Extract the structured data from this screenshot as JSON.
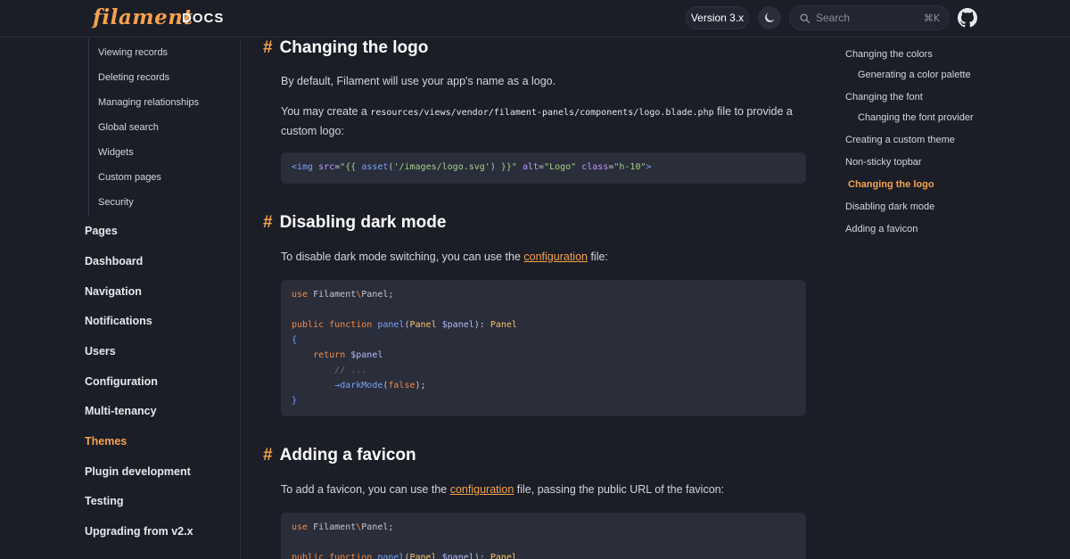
{
  "brand": {
    "wordmark": "filament",
    "docs_label": "DOCS"
  },
  "header": {
    "version_label": "Version 3.x",
    "search_placeholder": "Search",
    "search_shortcut": "⌘K"
  },
  "sidebar": {
    "sub_items": [
      "Viewing records",
      "Deleting records",
      "Managing relationships",
      "Global search",
      "Widgets",
      "Custom pages",
      "Security"
    ],
    "top_items": [
      "Pages",
      "Dashboard",
      "Navigation",
      "Notifications",
      "Users",
      "Configuration",
      "Multi-tenancy",
      "Themes",
      "Plugin development",
      "Testing",
      "Upgrading from v2.x"
    ],
    "active_item": "Themes"
  },
  "content": {
    "section_logo": {
      "heading": "Changing the logo",
      "para1": "By default, Filament will use your app's name as a logo.",
      "para2_before": "You may create a ",
      "para2_code": "resources/views/vendor/filament-panels/components/logo.blade.php",
      "para2_after": " file to provide a",
      "para2_line2": "custom logo:",
      "code": "<img src=\"{{ asset('/images/logo.svg') }}\" alt=\"Logo\" class=\"h-10\">"
    },
    "section_dark": {
      "heading": "Disabling dark mode",
      "para_before": "To disable dark mode switching, you can use the ",
      "para_link": "configuration",
      "para_after": " file:",
      "code_lines": [
        "use Filament\\Panel;",
        "",
        "public function panel(Panel $panel): Panel",
        "{",
        "    return $panel",
        "        // ...",
        "        ->darkMode(false);",
        "}"
      ]
    },
    "section_favicon": {
      "heading": "Adding a favicon",
      "para_before": "To add a favicon, you can use the ",
      "para_link": "configuration",
      "para_after": " file, passing the public URL of the favicon:",
      "code_lines": [
        "use Filament\\Panel;",
        "",
        "public function panel(Panel $panel): Panel"
      ]
    }
  },
  "toc": {
    "items": [
      "Changing the colors",
      "Generating a color palette",
      "Changing the font",
      "Changing the font provider",
      "Creating a custom theme",
      "Non-sticky topbar",
      "Changing the logo",
      "Disabling dark mode",
      "Adding a favicon"
    ]
  },
  "colors": {
    "accent": "#f5a34a",
    "background": "#1b1d27",
    "code_bg": "#2a2d3a"
  },
  "icons": [
    "moon-icon",
    "search-icon",
    "github-icon",
    "hash-icon"
  ]
}
